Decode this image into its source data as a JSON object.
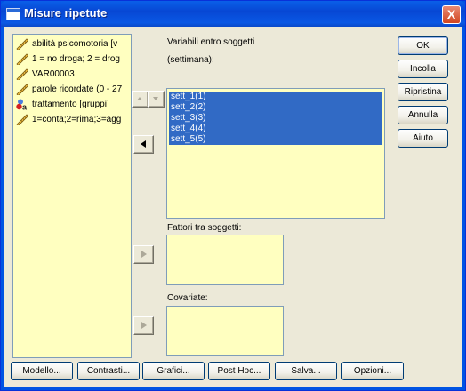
{
  "window": {
    "title": "Misure ripetute",
    "close_label": "X"
  },
  "source_variables": [
    {
      "label": "abilità psicomotoria  [v",
      "icon": "ruler-icon"
    },
    {
      "label": "1 = no droga; 2 = drog",
      "icon": "ruler-icon"
    },
    {
      "label": "VAR00003",
      "icon": "ruler-icon"
    },
    {
      "label": "parole ricordate (0 - 27",
      "icon": "ruler-icon"
    },
    {
      "label": "trattamento [gruppi]",
      "icon": "nominal-variable-icon"
    },
    {
      "label": "1=conta;2=rima;3=agg",
      "icon": "ruler-icon"
    }
  ],
  "within": {
    "label": "Variabili entro soggetti",
    "sublabel": "(settimana):",
    "items": [
      "sett_1(1)",
      "sett_2(2)",
      "sett_3(3)",
      "sett_4(4)",
      "sett_5(5)"
    ]
  },
  "between": {
    "label": "Fattori tra soggetti:"
  },
  "covariates": {
    "label": "Covariate:"
  },
  "side_buttons": {
    "ok": "OK",
    "paste": "Incolla",
    "reset": "Ripristina",
    "cancel": "Annulla",
    "help": "Aiuto"
  },
  "bottom_buttons": {
    "model": "Modello...",
    "contrasts": "Contrasti...",
    "plots": "Grafici...",
    "posthoc": "Post Hoc...",
    "save": "Salva...",
    "options": "Opzioni..."
  },
  "colors": {
    "list_bg": "#ffffc0",
    "selection": "#316ac5",
    "titlebar": "#0054e3",
    "dialog_bg": "#ece9d8"
  }
}
